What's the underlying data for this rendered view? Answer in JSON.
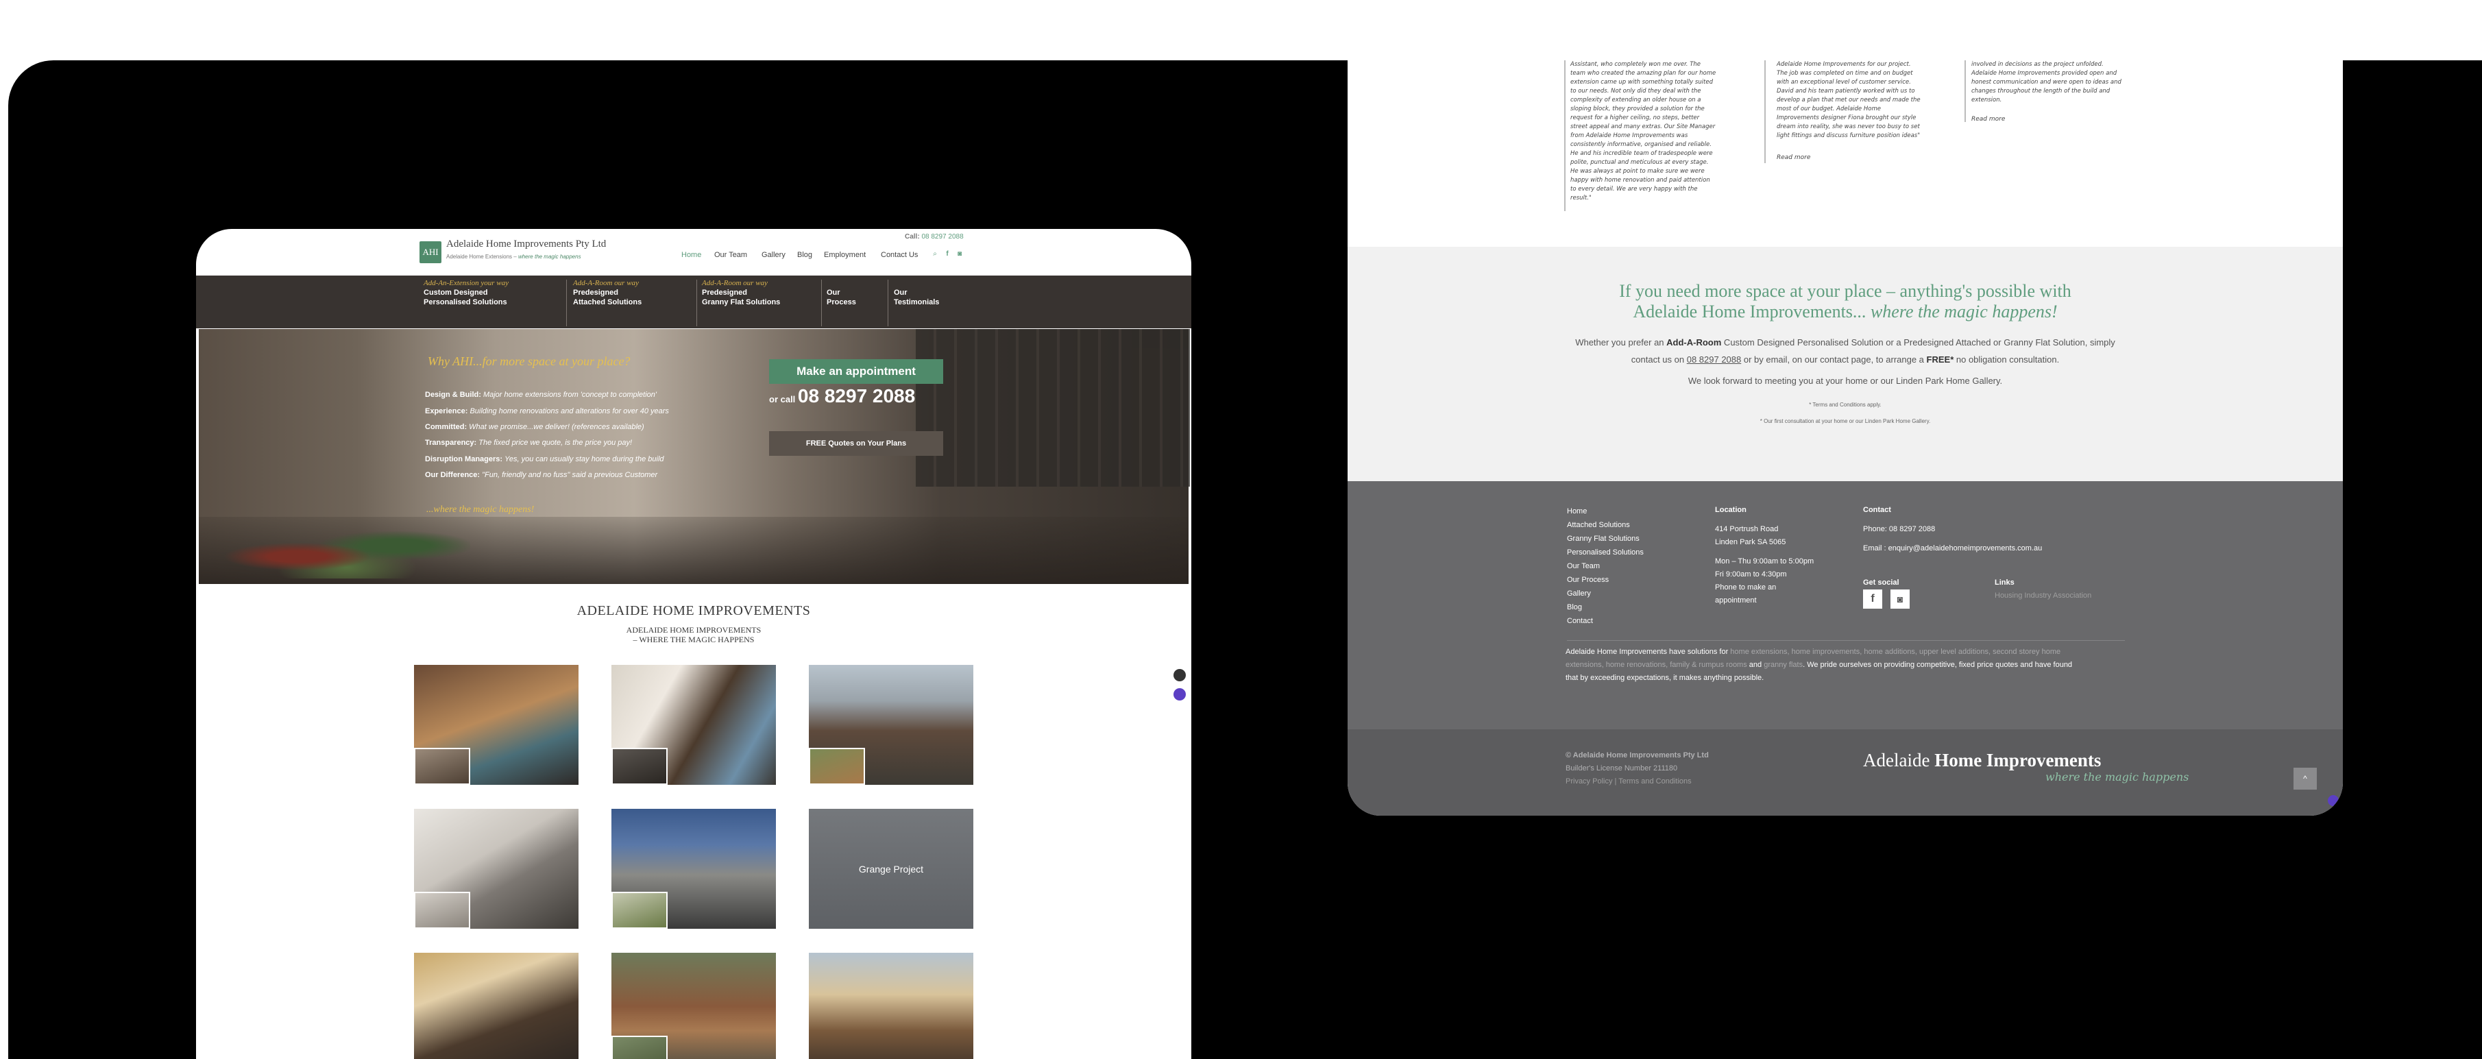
{
  "left": {
    "header": {
      "logo_text": "AHI",
      "brand": "Adelaide Home Improvements Pty Ltd",
      "tagline_a": "Adelaide Home Extensions – ",
      "tagline_b": "where the magic happens",
      "call_label": "Call: ",
      "call_number": "08 8297 2088",
      "nav": [
        "Home",
        "Our Team",
        "Gallery",
        "Blog",
        "Employment",
        "Contact Us"
      ],
      "active_nav": "Home",
      "icons": [
        "search-icon",
        "facebook-icon",
        "instagram-icon"
      ]
    },
    "menu": [
      {
        "script": "Add-An-Extension your way",
        "title1": "Custom Designed",
        "title2": "Personalised Solutions"
      },
      {
        "script": "Add-A-Room our way",
        "title1": "Predesigned",
        "title2": "Attached Solutions"
      },
      {
        "script": "Add-A-Room our way",
        "title1": "Predesigned",
        "title2": "Granny Flat Solutions"
      },
      {
        "script": "",
        "title1": "Our",
        "title2": "Process"
      },
      {
        "script": "",
        "title1": "Our",
        "title2": "Testimonials"
      }
    ],
    "hero": {
      "why": "Why AHI...for more space at your place?",
      "items": [
        {
          "label": "Design & Build:",
          "text": "Major home extensions from 'concept to completion'"
        },
        {
          "label": "Experience:",
          "text": "Building home renovations and alterations for over 40 years"
        },
        {
          "label": "Committed:",
          "text": "What we promise...we deliver! (references available)"
        },
        {
          "label": "Transparency:",
          "text": "The fixed price we quote, is the price you pay!"
        },
        {
          "label": "Disruption Managers:",
          "text": "Yes, you can usually stay home during the build"
        },
        {
          "label": "Our Difference:",
          "text": "\"Fun, friendly and no fuss\" said a previous Customer"
        }
      ],
      "magic": "...where the magic happens!",
      "appointment_button": "Make an appointment",
      "or_call": "or call ",
      "phone": "08 8297 2088",
      "quotes_button": "FREE Quotes on Your Plans"
    },
    "section": {
      "title": "ADELAIDE HOME IMPROVEMENTS",
      "sub1": "ADELAIDE HOME IMPROVEMENTS",
      "sub2": "– WHERE THE MAGIC HAPPENS"
    },
    "gallery": {
      "hover_label": "Grange Project",
      "tile_count": 9
    },
    "colors": {
      "green": "#4f8a6a",
      "gold": "#e6c04f",
      "menu_bg": "#383330"
    }
  },
  "right": {
    "testimonials": {
      "col1": "Assistant, who completely won me over. The team who created the amazing plan for our home extension came up with something totally suited to our needs. Not only did they deal with the complexity of extending an older house on a sloping block, they provided a solution for the request for a higher ceiling, no steps, better street appeal and many extras. Our Site Manager from Adelaide Home Improvements was consistently informative, organised and reliable. He and his incredible team of tradespeople were polite, punctual and meticulous at every stage. He was always at point to make sure we were happy with home renovation and paid attention to every detail. We are very happy with the result.\"",
      "col2": "Adelaide Home Improvements for our project. The job was completed on time and on budget with an exceptional level of customer service. David and his team patiently worked with us to develop a plan that met our needs and made the most of our budget. Adelaide Home Improvements designer Fiona brought our style dream into reality, she was never too busy to set light fittings and discuss furniture position ideas\"",
      "col3": "involved in decisions as the project unfolded. Adelaide Home Improvements provided open and honest communication and were open to ideas and changes throughout the length of the build and extension.",
      "read_more": "Read more"
    },
    "cta": {
      "heading1": "If you need more space at your place – anything's possible with",
      "heading2a": "Adelaide Home Improvements... ",
      "heading2b": "where the magic happens!",
      "p1a": "Whether you prefer an ",
      "p1b": "Add-A-Room",
      "p1c": " Custom Designed Personalised Solution or a Predesigned Attached or Granny Flat Solution, simply",
      "p2a": "contact us on ",
      "p2b": "08 8297 2088",
      "p2c": " or by email, on our contact page, to arrange a ",
      "p2d": "FREE*",
      "p2e": " no obligation consultation.",
      "p3": "We look forward to meeting you at your home or our Linden Park Home Gallery.",
      "s1": "* Terms and Conditions apply.",
      "s2": "* Our first consultation at your home or our Linden Park Home Gallery."
    },
    "footer": {
      "links": [
        "Home",
        "Attached Solutions",
        "Granny Flat Solutions",
        "Personalised Solutions",
        "Our Team",
        "Our Process",
        "Gallery",
        "Blog",
        "Contact"
      ],
      "location_title": "Location",
      "address1": "414 Portrush Road",
      "address2": "Linden Park SA 5065",
      "hours1": "Mon – Thu 9:00am to 5:00pm",
      "hours2": "Fri 9:00am to 4:30pm",
      "hours3": "Phone to make an",
      "hours4": "appointment",
      "contact_title": "Contact",
      "phone": "Phone: 08 8297 2088",
      "email": "Email : enquiry@adelaidehomeimprovements.com.au",
      "social_title": "Get social",
      "links_title": "Links",
      "hia": "Housing Industry Association",
      "about1a": "Adelaide Home Improvements have solutions for ",
      "about1b": "home extensions, home improvements, home additions, upper level additions, second storey home",
      "about2a": "extensions, home renovations, family & rumpus rooms",
      "about2b": " and ",
      "about2c": "granny flats",
      "about2d": ". We pride ourselves on providing competitive, fixed price quotes and have found",
      "about3": "that by exceeding expectations, it makes anything possible.",
      "copyright": "© Adelaide Home Improvements Pty Ltd",
      "license": "Builder's License Number 211180",
      "privacy": "Privacy Policy",
      "terms": "Terms and Conditions",
      "brand_a": "Adelaide ",
      "brand_b": "Home Improvements",
      "brand_tag": "where the magic happens",
      "up": "^"
    }
  }
}
